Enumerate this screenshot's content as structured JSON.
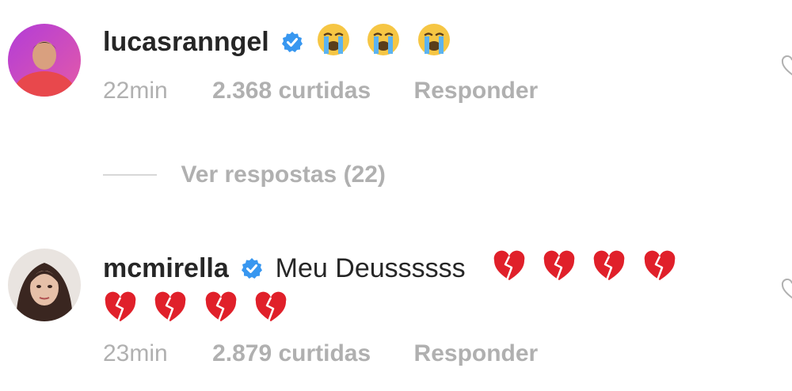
{
  "comments": [
    {
      "username": "lucasranngel",
      "verified": true,
      "text": "",
      "emojis": [
        "crying-face",
        "crying-face",
        "crying-face"
      ],
      "time": "22min",
      "likes": "2.368 curtidas",
      "reply_label": "Responder",
      "avatar_icon": "user-avatar-icon"
    },
    {
      "username": "mcmirella",
      "verified": true,
      "text": "Meu Deussssss",
      "emojis": [
        "broken-heart",
        "broken-heart",
        "broken-heart",
        "broken-heart",
        "broken-heart",
        "broken-heart",
        "broken-heart",
        "broken-heart"
      ],
      "time": "23min",
      "likes": "2.879 curtidas",
      "reply_label": "Responder",
      "avatar_icon": "user-avatar-icon"
    }
  ],
  "view_replies": {
    "label": "Ver respostas (22)"
  },
  "colors": {
    "text": "#262626",
    "muted": "#b0b0b0",
    "verified_blue": "#3897f0",
    "broken_heart": "#e0202a",
    "crying_face": "#f6c644"
  }
}
